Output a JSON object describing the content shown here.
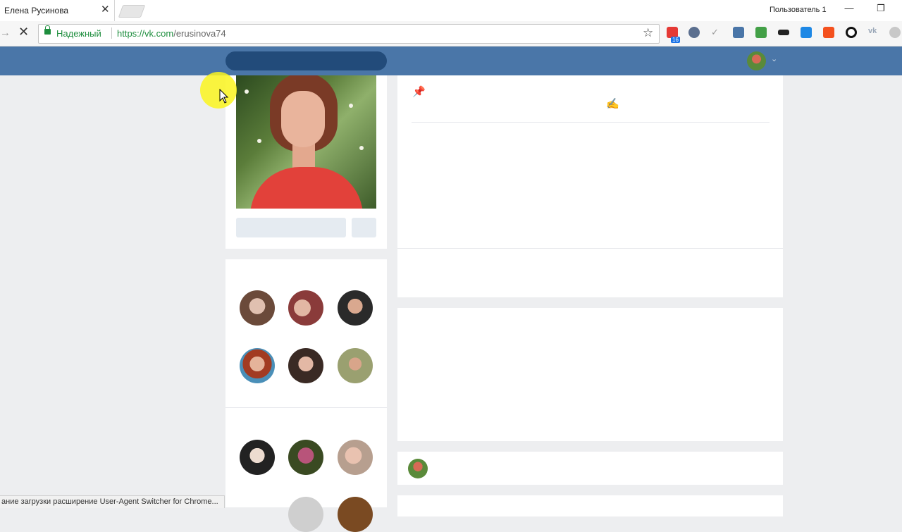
{
  "browser": {
    "tab_title": "Елена Русинова",
    "tab_close": "✕",
    "profile_label": "Пользователь 1",
    "secure_label": "Надежный",
    "url_scheme_host": "https://vk.com",
    "url_path": "/erusinova74",
    "status_text": "ание загрузки расширение User-Agent Switcher for Chrome...",
    "ext_badge": "16",
    "window_minimize": "—",
    "window_restore": "❐"
  },
  "icons": {
    "star": "☆",
    "stop": "✕",
    "forward": "→",
    "pin": "📌",
    "edit": "✍",
    "caret": "⌄"
  },
  "colors": {
    "vk_header": "#4a76a8",
    "page_bg": "#edeef0",
    "secure_green": "#1e8e3e"
  }
}
